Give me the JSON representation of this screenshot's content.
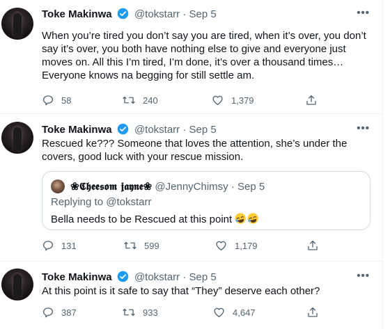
{
  "tweets": [
    {
      "name": "Toke Makinwa",
      "handle": "@tokstarr",
      "dot": "·",
      "date": "Sep 5",
      "more": "•••",
      "text": "When you’re tired you don’t say you are tired, when it’s over, you don’t say it’s over, you both have nothing else to give and everyone just moves on. All this I’m tired, I’m done, it’s over a thousand times… Everyone knows na begging for still settle am.",
      "replies": "58",
      "retweets": "240",
      "likes": "1,379"
    },
    {
      "name": "Toke Makinwa",
      "handle": "@tokstarr",
      "dot": "·",
      "date": "Sep 5",
      "more": "•••",
      "text": "Rescued ke??? Someone that loves the attention, she’s under the covers, good luck with your rescue mission.",
      "replies": "131",
      "retweets": "599",
      "likes": "1,179",
      "quote": {
        "name": "❀𝕮𝖍𝖊𝖊𝖘𝖔𝖒 𝖏𝖆𝖞𝖓𝖊❀",
        "handle": "@JennyChimsy",
        "dot": "·",
        "date": "Sep 5",
        "replying": "Replying to @tokstarr",
        "text": "Bella needs to be Rescued at this point"
      }
    },
    {
      "name": "Toke Makinwa",
      "handle": "@tokstarr",
      "dot": "·",
      "date": "Sep 5",
      "more": "•••",
      "text": "At this point is it safe to say that “They” deserve each other?",
      "replies": "387",
      "retweets": "933",
      "likes": "4,647"
    }
  ],
  "icons": [
    "verified-icon",
    "reply-icon",
    "retweet-icon",
    "like-icon",
    "share-icon",
    "more-icon",
    "laughing-emoji"
  ],
  "colors": {
    "text": "#0f1419",
    "secondary": "#536471",
    "verified": "#1d9bf0",
    "border": "#cfd9de",
    "emoji": "#ffcc33"
  }
}
